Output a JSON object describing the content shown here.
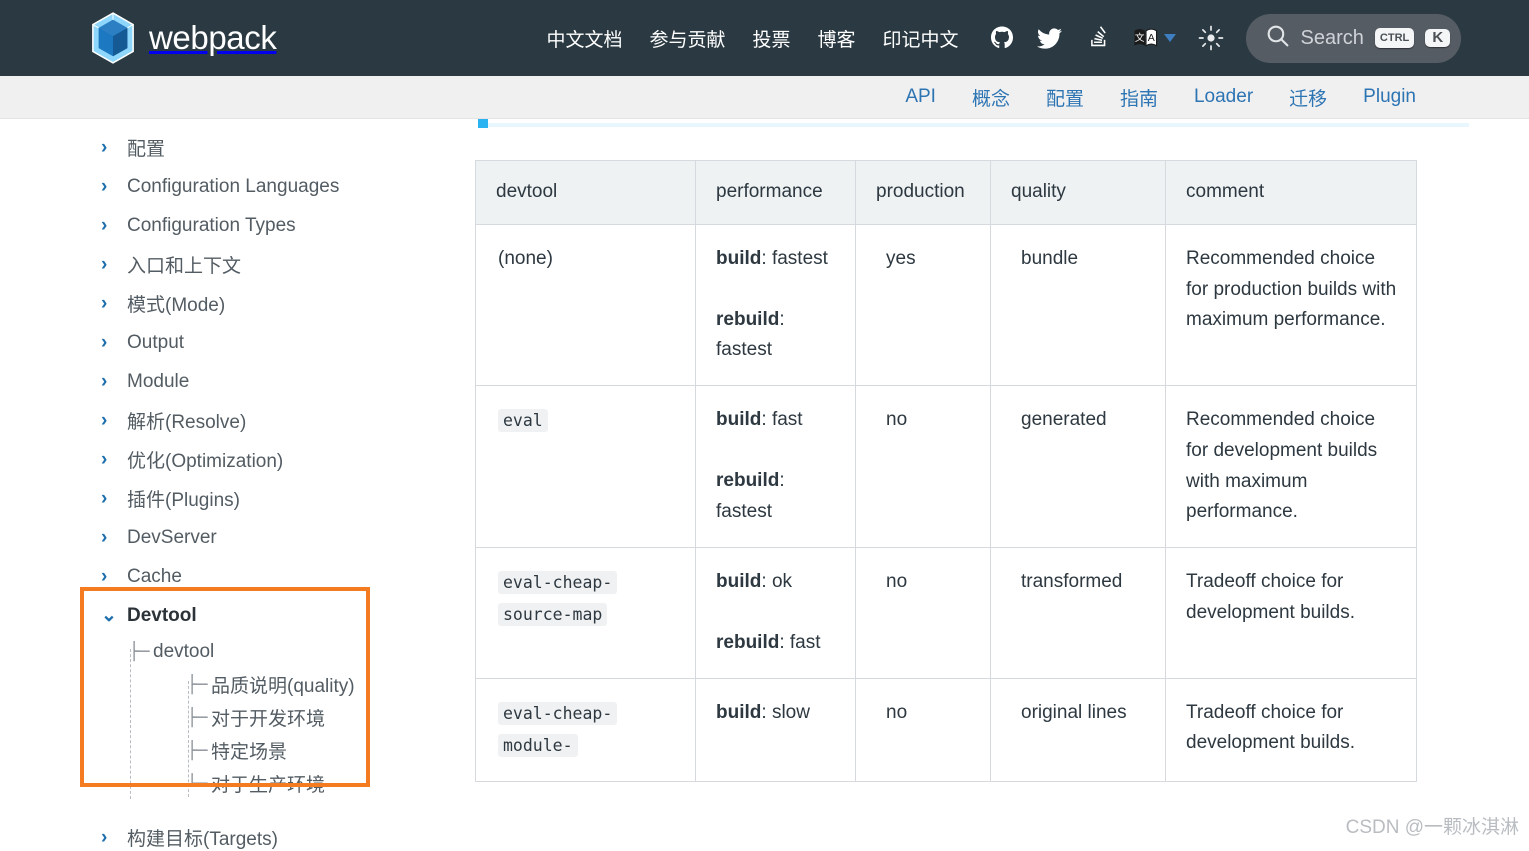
{
  "header": {
    "brand": "webpack",
    "logo_icon": "webpack-cube-logo",
    "nav_links": [
      {
        "label": "中文文档"
      },
      {
        "label": "参与贡献"
      },
      {
        "label": "投票"
      },
      {
        "label": "博客"
      },
      {
        "label": "印记中文"
      }
    ],
    "icons": [
      {
        "name": "github-icon"
      },
      {
        "name": "twitter-icon"
      },
      {
        "name": "stackoverflow-icon"
      },
      {
        "name": "translate-icon"
      },
      {
        "name": "theme-sun-icon"
      }
    ],
    "search": {
      "placeholder": "Search",
      "icon": "search-icon",
      "shortcut_modifier": "CTRL",
      "shortcut_key": "K"
    }
  },
  "subnav": {
    "items": [
      {
        "label": "API"
      },
      {
        "label": "概念"
      },
      {
        "label": "配置"
      },
      {
        "label": "指南"
      },
      {
        "label": "Loader"
      },
      {
        "label": "迁移"
      },
      {
        "label": "Plugin"
      }
    ]
  },
  "sidebar": {
    "chevron_collapsed": "›",
    "chevron_expanded": "⌄",
    "items": [
      {
        "label": "配置"
      },
      {
        "label": "Configuration Languages"
      },
      {
        "label": "Configuration Types"
      },
      {
        "label": "入口和上下文"
      },
      {
        "label": "模式(Mode)"
      },
      {
        "label": "Output"
      },
      {
        "label": "Module"
      },
      {
        "label": "解析(Resolve)"
      },
      {
        "label": "优化(Optimization)"
      },
      {
        "label": "插件(Plugins)"
      },
      {
        "label": "DevServer"
      },
      {
        "label": "Cache"
      }
    ],
    "devtool_group": {
      "label": "Devtool",
      "children": [
        {
          "label": "devtool",
          "connector": "├─",
          "level": 1
        },
        {
          "label": "品质说明(quality)",
          "connector": "├─",
          "level": 2
        },
        {
          "label": "对于开发环境",
          "connector": "├─",
          "level": 2
        },
        {
          "label": "特定场景",
          "connector": "├─",
          "level": 2
        },
        {
          "label": "对于生产环境",
          "connector": "└─",
          "level": 2
        }
      ],
      "highlight_color": "#f47b20"
    },
    "items_after": [
      {
        "label": "构建目标(Targets)"
      }
    ]
  },
  "main": {
    "table": {
      "headers": [
        "devtool",
        "performance",
        "production",
        "quality",
        "comment"
      ],
      "rows": [
        {
          "devtool": "(none)",
          "devtool_is_code": false,
          "build_label": "build",
          "build_value": "fastest",
          "rebuild_label": "rebuild",
          "rebuild_value": "fastest",
          "production": "yes",
          "quality": "bundle",
          "comment": "Recommended choice for production builds with maximum performance."
        },
        {
          "devtool": "eval",
          "devtool_is_code": true,
          "build_label": "build",
          "build_value": "fast",
          "rebuild_label": "rebuild",
          "rebuild_value": "fastest",
          "production": "no",
          "quality": "generated",
          "comment": "Recommended choice for development builds with maximum performance."
        },
        {
          "devtool": "eval-cheap-source-map",
          "devtool_is_code": true,
          "build_label": "build",
          "build_value": "ok",
          "rebuild_label": "rebuild",
          "rebuild_value": "fast",
          "production": "no",
          "quality": "transformed",
          "comment": "Tradeoff choice for development builds."
        },
        {
          "devtool": "eval-cheap-module-",
          "devtool_is_code": true,
          "build_label": "build",
          "build_value": "slow",
          "rebuild_label": "",
          "rebuild_value": "",
          "production": "no",
          "quality": "original lines",
          "comment": "Tradeoff choice for development builds."
        }
      ]
    }
  },
  "watermark": "CSDN @一颗冰淇淋"
}
